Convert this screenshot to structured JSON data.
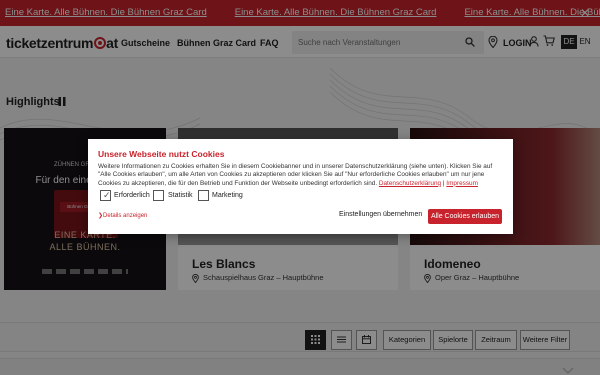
{
  "ticker": {
    "items": [
      "Eine Karte. Alle Bühnen. Die Bühnen Graz Card",
      "Eine Karte. Alle Bühnen. Die Bühnen Graz Card",
      "Eine Karte. Alle Bühnen. Die Bühnen Graz Card"
    ],
    "close": "✕"
  },
  "header": {
    "logo": "ticketzentrum",
    "logo_suffix": "at",
    "nav": [
      "Gutscheine",
      "Bühnen Graz Card",
      "FAQ"
    ],
    "search_placeholder": "Suche nach Veranstaltungen",
    "login": "LOGIN",
    "languages": [
      "DE",
      "EN"
    ]
  },
  "main": {
    "highlights_title": "Highlights",
    "promo": {
      "top": "ZÜHNEN GRAZ CARD",
      "headline": "Für den einen Buhnen",
      "panel_button": "Bühnen Graz Card",
      "line1": "EINE KARTE.",
      "line2": "ALLE BÜHNEN."
    },
    "events": [
      {
        "title": "Les Blancs",
        "venue": "Schauspielhaus Graz – Hauptbühne"
      },
      {
        "title": "Idomeneo",
        "venue": "Oper Graz – Hauptbühne"
      }
    ],
    "filters": [
      "Kategorien",
      "Spielorte",
      "Zeitraum",
      "Weitere Filter"
    ]
  },
  "cookie": {
    "title": "Unsere Webseite nutzt Cookies",
    "text": "Weitere Informationen zu Cookies erhalten Sie in diesem Cookiebanner und in unserer Datenschutzerklärung (siehe unten). Klicken Sie auf \"Alle Cookies erlauben\", um alle Arten von Cookies zu akzeptieren oder klicken Sie auf \"Nur erforderliche Cookies erlauben\" um nur jene Cookies zu akzeptieren, die für den Betrieb und Funktion der Webseite unbedingt erforderlich sind.",
    "privacy_link": "Datenschutzerklärung",
    "separator": "|",
    "imprint_link": "Impressum",
    "options": [
      {
        "label": "Erforderlich",
        "checked": true
      },
      {
        "label": "Statistik",
        "checked": false
      },
      {
        "label": "Marketing",
        "checked": false
      }
    ],
    "details": "Details anzeigen",
    "save": "Einstellungen übernehmen",
    "accept_all": "Alle Cookies erlauben"
  }
}
